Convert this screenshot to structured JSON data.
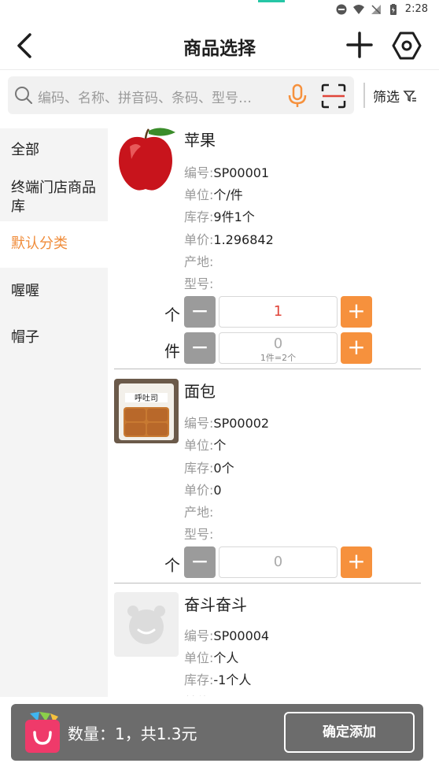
{
  "status_bar": {
    "time": "2:28"
  },
  "header": {
    "title": "商品选择"
  },
  "search": {
    "placeholder": "编码、名称、拼音码、条码、型号…",
    "filter_label": "筛选"
  },
  "sidebar": {
    "items": [
      {
        "label": "全部",
        "active": false
      },
      {
        "label": "终端门店商品库",
        "active": false
      },
      {
        "label": "默认分类",
        "active": true
      },
      {
        "label": "喔喔",
        "active": false
      },
      {
        "label": "帽子",
        "active": false
      }
    ]
  },
  "field_labels": {
    "code": "编号:",
    "unit": "单位:",
    "stock": "库存:",
    "price": "单价:",
    "origin": "产地:",
    "model": "型号:"
  },
  "products": [
    {
      "name": "苹果",
      "code": "SP00001",
      "unit": "个/件",
      "stock": "9件1个",
      "price": "1.296842",
      "origin": "",
      "model": "",
      "image": "apple-image",
      "qty_rows": [
        {
          "unit": "个",
          "value": "1",
          "hint": ""
        },
        {
          "unit": "件",
          "value": "0",
          "hint": "1件=2个"
        }
      ]
    },
    {
      "name": "面包",
      "code": "SP00002",
      "unit": "个",
      "stock": "0个",
      "price": "0",
      "origin": "",
      "model": "",
      "image": "bread-image",
      "image_text": "呼吐司",
      "qty_rows": [
        {
          "unit": "个",
          "value": "0",
          "hint": ""
        }
      ]
    },
    {
      "name": "奋斗奋斗",
      "code": "SP00004",
      "unit": "个人",
      "stock": "-1个人",
      "image": "placeholder-image"
    }
  ],
  "buttons": {
    "minus": "−",
    "plus": "+"
  },
  "bottom": {
    "summary": "数量：1，共1.3元",
    "confirm_label": "确定添加"
  },
  "colors": {
    "accent": "#f6913d",
    "active_category": "#f08c3a",
    "qty_red": "#e0453a",
    "bottom_bar": "#6c6c6c"
  }
}
